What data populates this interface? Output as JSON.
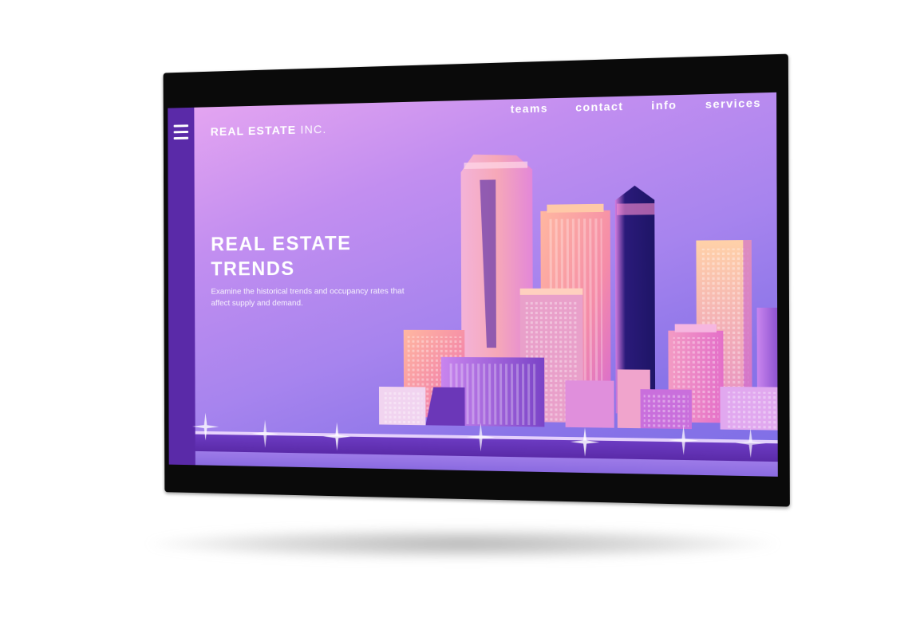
{
  "brand": {
    "bold": "REAL ESTATE",
    "light": "INC."
  },
  "nav": {
    "items": [
      "teams",
      "contact",
      "info",
      "services"
    ]
  },
  "hero": {
    "title_line1": "REAL ESTATE",
    "title_line2": "TRENDS",
    "description": "Examine the historical trends and occupancy rates that affect supply and demand."
  },
  "icons": {
    "menu": "hamburger-menu-icon"
  },
  "colors": {
    "sidebar": "#5a2aa8",
    "gradient_start": "#e6a6f1",
    "gradient_end": "#7d6ee6",
    "text": "#ffffff"
  }
}
